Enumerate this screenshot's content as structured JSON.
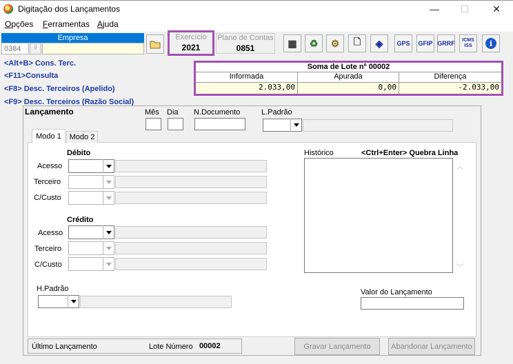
{
  "window": {
    "title": "Digitação dos Lançamentos",
    "minimize": "—",
    "maximize": "☐",
    "close": "✕"
  },
  "menu": [
    {
      "label": "Opções",
      "key": "O"
    },
    {
      "label": "Ferramentas",
      "key": "F"
    },
    {
      "label": "Ajuda",
      "key": "A"
    }
  ],
  "empresa": {
    "header": "Empresa",
    "code": "0384",
    "name": ""
  },
  "exercicio": {
    "label": "Exercício",
    "value": "2021"
  },
  "plano": {
    "label": "Plano de Contas",
    "value": "0851"
  },
  "toolbar": [
    {
      "name": "calculator-icon",
      "glyph": "▦"
    },
    {
      "name": "recycle-bin-icon",
      "glyph": "♻"
    },
    {
      "name": "gear-tool-icon",
      "glyph": "⚙"
    },
    {
      "name": "new-document-icon",
      "glyph": "🗋"
    },
    {
      "name": "compass-icon",
      "glyph": "◈"
    },
    {
      "name": "gps-icon",
      "glyph": "GPS"
    },
    {
      "name": "gfip-icon",
      "glyph": "GFIP"
    },
    {
      "name": "grrf-icon",
      "glyph": "GRRF"
    },
    {
      "name": "icms-iss-icon",
      "glyph": "ICMS ISS"
    },
    {
      "name": "info-icon",
      "glyph": "i"
    }
  ],
  "shortcuts": [
    "<Alt+B> Cons. Terc.",
    "<F11>Consulta",
    "<F8> Desc. Terceiros (Apelido)",
    "<F9> Desc. Terceiros (Razão Social)"
  ],
  "lote": {
    "title": "Soma de Lote nº 00002",
    "headers": [
      "Informada",
      "Apurada",
      "Diferença"
    ],
    "values": [
      "2.033,00",
      "0,00",
      "-2.033,00"
    ]
  },
  "lancamento": {
    "section": "Lançamento",
    "mes": "Mês",
    "dia": "Dia",
    "ndoc": "N.Documento",
    "lpadrao": "L.Padrão",
    "tabs": [
      "Modo 1",
      "Modo 2"
    ],
    "debito": "Débito",
    "credito": "Crédito",
    "acesso": "Acesso",
    "terceiro": "Terceiro",
    "ccusto": "C/Custo",
    "historico": "Histórico",
    "quebra": "<Ctrl+Enter> Quebra Linha",
    "hpadrao": "H.Padrão",
    "valor": "Valor do Lançamento"
  },
  "footer": {
    "ultimo": "Último Lançamento",
    "lote_label": "Lote Número",
    "lote_num": "00002",
    "gravar": "Gravar Lançamento",
    "abandonar": "Abandonar Lançamento"
  }
}
